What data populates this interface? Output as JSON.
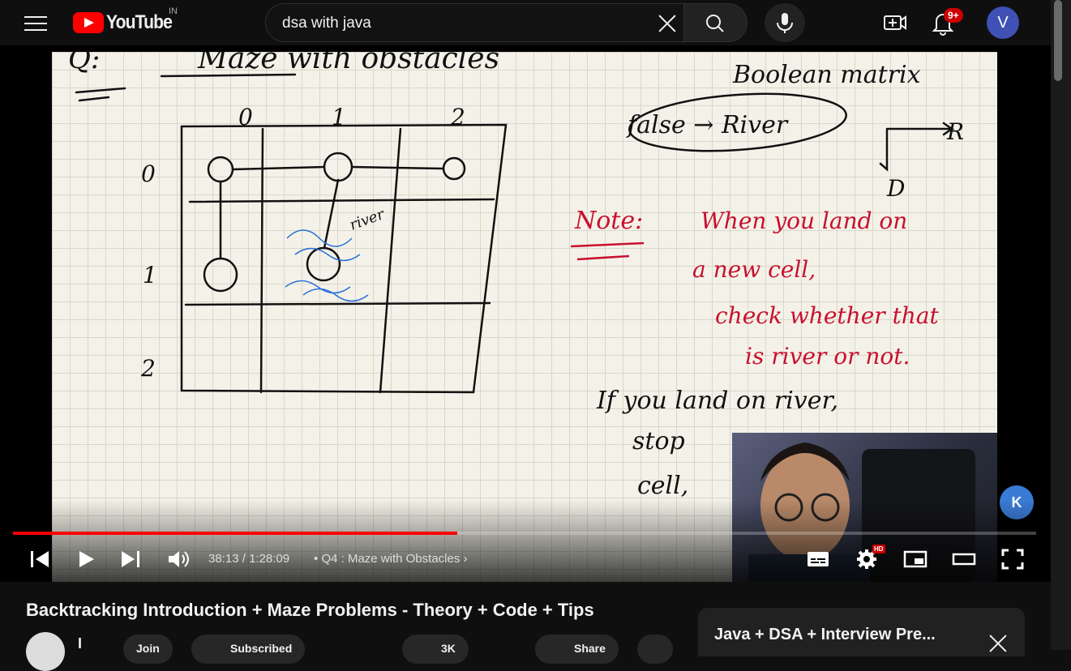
{
  "header": {
    "logo_text": "YouTube",
    "country_code": "IN",
    "search_value": "dsa with java",
    "notification_count": "9+",
    "avatar_letter": "V"
  },
  "player": {
    "current_time": "38:13",
    "separator": "/",
    "duration": "1:28:09",
    "chapter": "Q4 : Maze with Obstacles",
    "hd_badge": "HD",
    "watermark": "K",
    "progress_fraction": 0.434,
    "whiteboard": {
      "question_label": "Q:",
      "heading": "Maze with obstacles",
      "col_labels": [
        "0",
        "1",
        "2"
      ],
      "row_labels": [
        "0",
        "1",
        "2"
      ],
      "boolean_label": "Boolean matrix",
      "false_river": "false → River",
      "right_label": "R",
      "down_label": "D",
      "river_label": "river",
      "note_label": "Note:",
      "note_lines": [
        "When you land on",
        "a new cell,",
        "check whether that",
        "is river or not."
      ],
      "rule_lines": [
        "If you land on river,",
        "stop",
        "cell,"
      ]
    }
  },
  "video": {
    "title": "Backtracking Introduction + Maze Problems - Theory + Code + Tips",
    "channel_name": "I",
    "join_label": "Join",
    "subscribe_label": "Subscribed",
    "like_count": "3K",
    "share_label": "Share"
  },
  "playlist": {
    "title": "Java + DSA + Interview Pre..."
  },
  "colors": {
    "accent": "#ff0000",
    "ink_black": "#111111",
    "ink_red": "#c8102e",
    "ink_blue": "#2a6fdb"
  }
}
